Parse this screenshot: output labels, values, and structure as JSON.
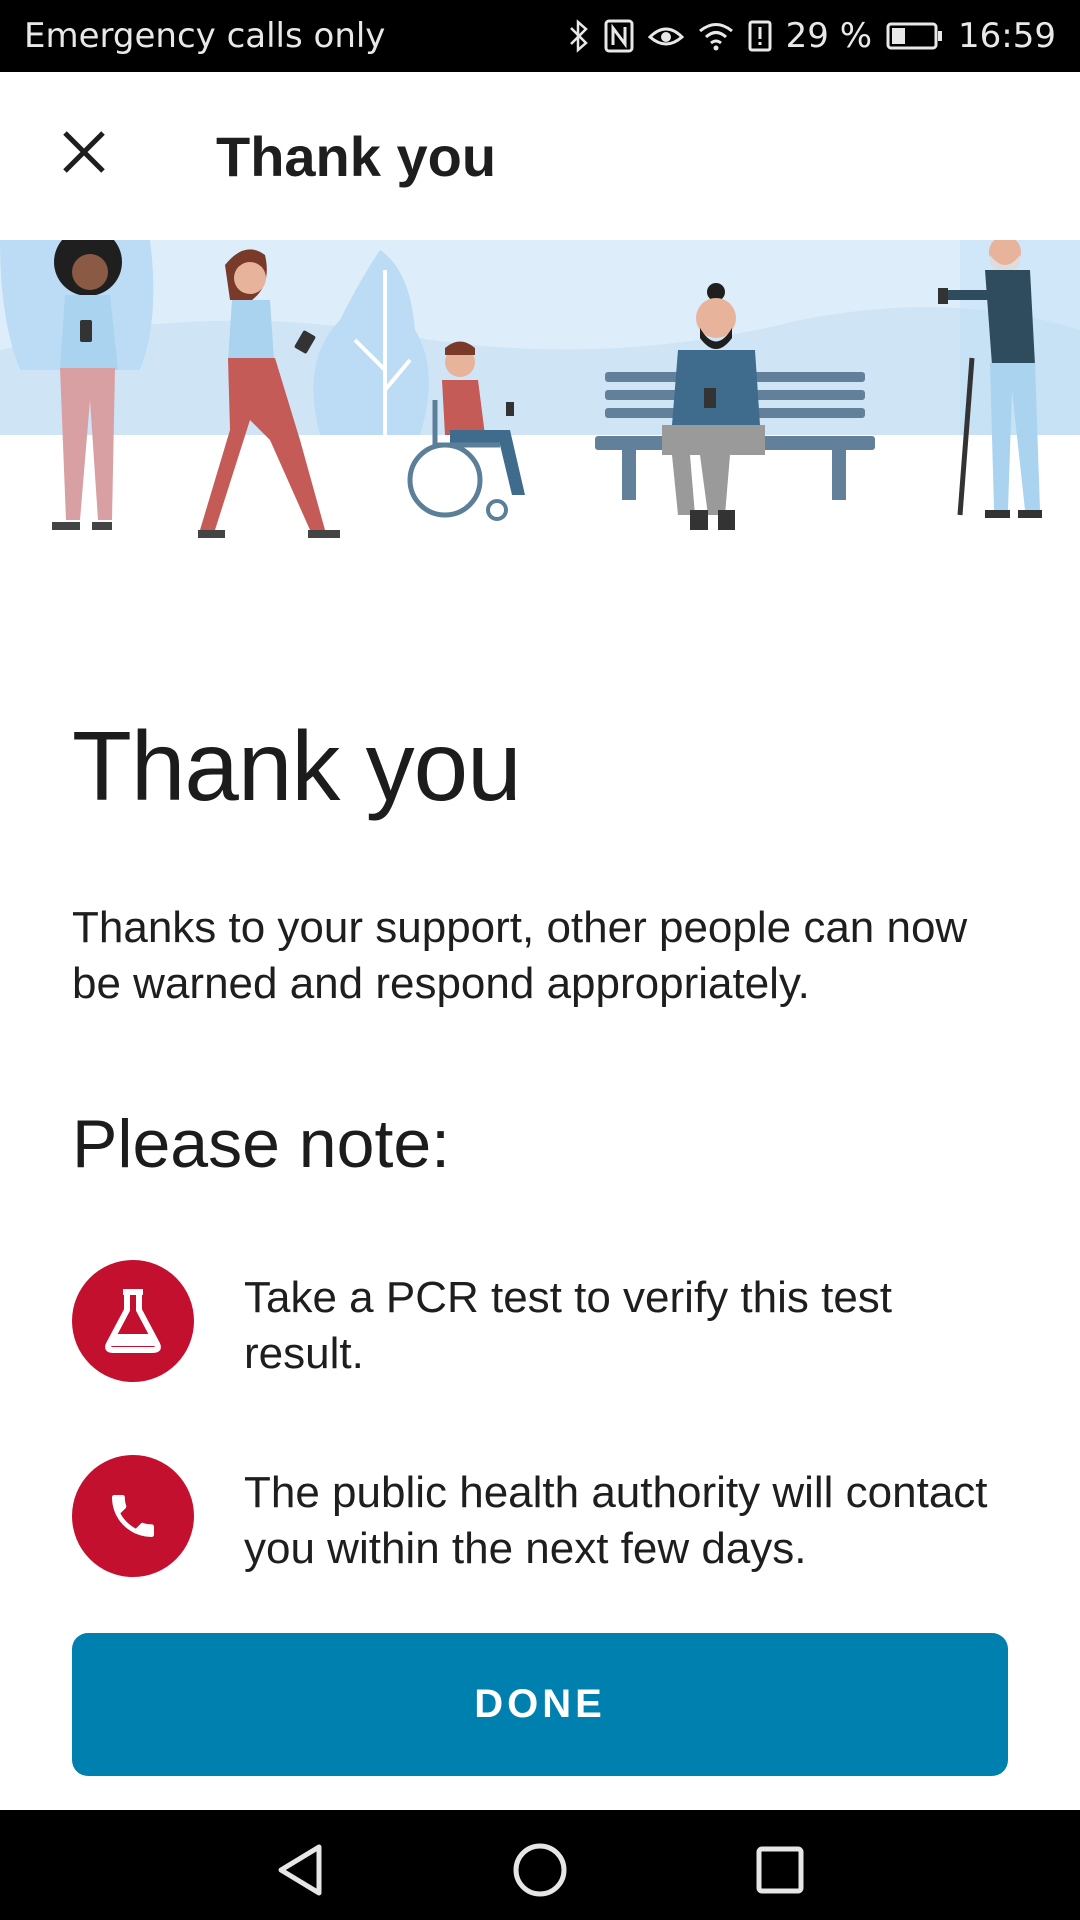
{
  "status_bar": {
    "carrier_text": "Emergency calls only",
    "battery_percent": "29 %",
    "time": "16:59",
    "icons": [
      "bluetooth-icon",
      "nfc-icon",
      "eye-comfort-icon",
      "wifi-icon",
      "alert-icon",
      "battery-icon"
    ]
  },
  "app_bar": {
    "title": "Thank you",
    "close_icon": "close-icon"
  },
  "content": {
    "title": "Thank you",
    "description": "Thanks to your support, other people can now be warned and respond appropriately.",
    "subheading": "Please note:",
    "notes": [
      {
        "icon": "flask-icon",
        "text": "Take a PCR test to verify this test result."
      },
      {
        "icon": "phone-icon",
        "text": "The public health authority will contact you within the next few days."
      }
    ]
  },
  "actions": {
    "done_label": "DONE"
  },
  "navigation": {
    "back_icon": "back-icon",
    "home_icon": "home-icon",
    "recents_icon": "recents-icon"
  },
  "colors": {
    "accent": "#0080ae",
    "note_icon_bg": "#c3102f",
    "hero_bg": "#ddeefa"
  }
}
